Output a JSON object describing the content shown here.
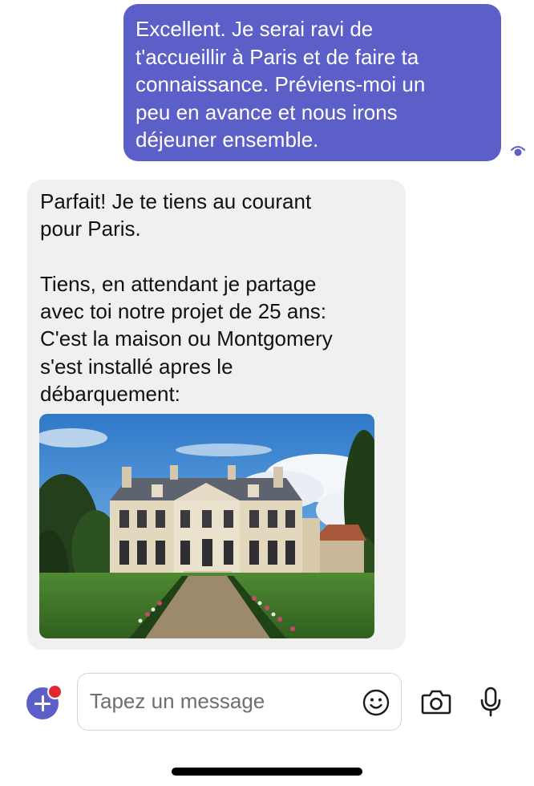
{
  "conversation": {
    "messages": [
      {
        "direction": "sent",
        "text": "Excellent. Je serai ravi de\nt'accueillir à Paris et de faire ta\nconnaissance. Préviens-moi un\npeu en avance et nous irons\ndéjeuner ensemble.",
        "status_icon": "read-receipt-eye-icon"
      },
      {
        "direction": "received",
        "text": "Parfait! Je te tiens au courant\npour Paris.\n\nTiens, en attendant je partage\navec toi notre projet de 25 ans:\nC'est la maison ou Montgomery\ns'est installé apres le\ndébarquement:",
        "attachment": "photo-of-chateau"
      }
    ]
  },
  "composer": {
    "placeholder": "Tapez un message",
    "value": "",
    "icons": {
      "add": "plus-icon",
      "emoji": "smiley-icon",
      "camera": "camera-icon",
      "microphone": "microphone-icon"
    }
  },
  "colors": {
    "accent": "#5c5fc8",
    "received_bubble": "#f0f0f1",
    "notification": "#e0262e"
  }
}
